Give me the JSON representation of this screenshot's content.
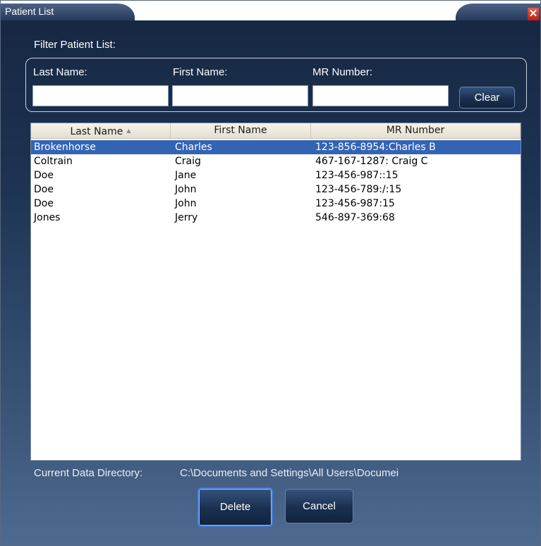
{
  "window": {
    "title": "Patient List"
  },
  "filter": {
    "heading": "Filter Patient List:",
    "last_name_label": "Last Name:",
    "first_name_label": "First Name:",
    "mr_number_label": "MR Number:",
    "last_name_value": "",
    "first_name_value": "",
    "mr_number_value": "",
    "clear_label": "Clear"
  },
  "table": {
    "columns": [
      "Last Name",
      "First Name",
      "MR Number"
    ],
    "sorted_column": "Last Name",
    "sort_direction": "ascending",
    "selected_row": 0,
    "rows": [
      {
        "last": "Brokenhorse",
        "first": "Charles",
        "mr": "123-856-8954:Charles B"
      },
      {
        "last": "Coltrain",
        "first": "Craig",
        "mr": "467-167-1287: Craig C"
      },
      {
        "last": "Doe",
        "first": "Jane",
        "mr": "123-456-987::15"
      },
      {
        "last": "Doe",
        "first": "John",
        "mr": "123-456-789:/:15"
      },
      {
        "last": "Doe",
        "first": "John",
        "mr": "123-456-987:15"
      },
      {
        "last": "Jones",
        "first": "Jerry",
        "mr": "546-897-369:68"
      }
    ]
  },
  "directory": {
    "label": "Current Data Directory:",
    "path": "C:\\Documents and Settings\\All Users\\Documei"
  },
  "actions": {
    "delete_label": "Delete",
    "cancel_label": "Cancel"
  },
  "icons": {
    "close": "close-icon",
    "sort": "sort-ascending-icon"
  },
  "colors": {
    "selection": "#3364b4",
    "close_button": "#c8281a"
  }
}
